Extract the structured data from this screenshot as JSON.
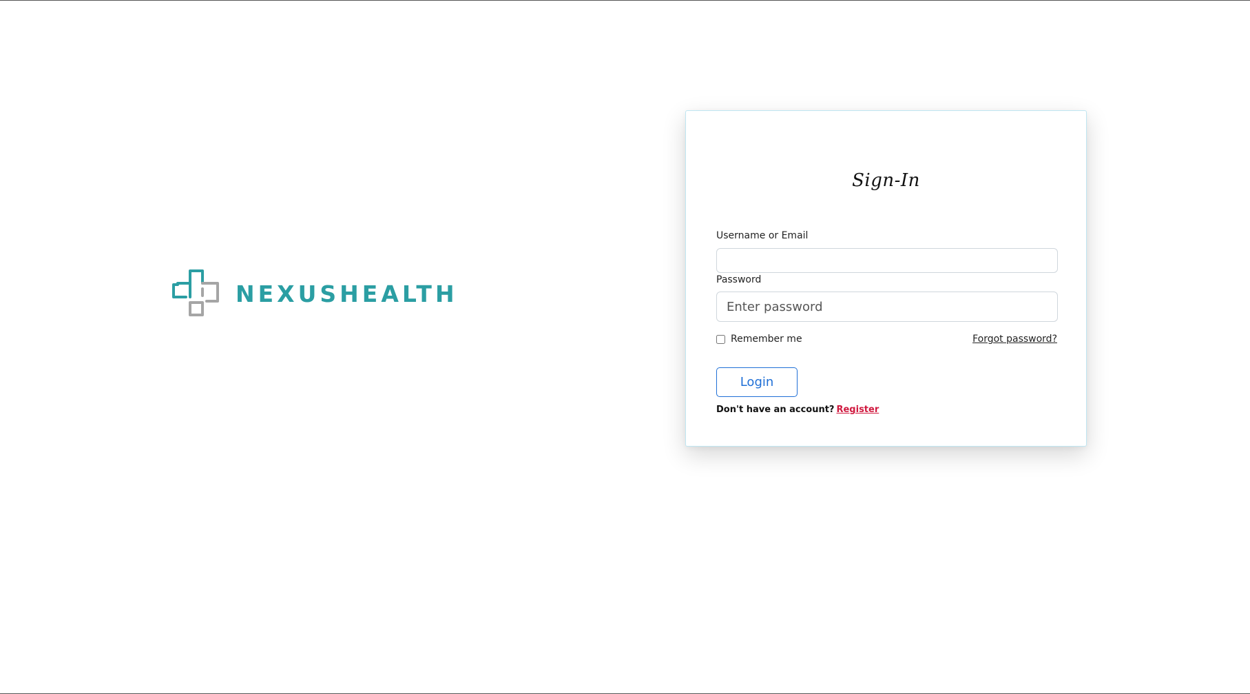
{
  "brand": {
    "name": "NEXUSHEALTH",
    "logo_icon": "medical-cross-logo-icon",
    "primary_color": "#2b9ea3",
    "secondary_color": "#a5a5a5"
  },
  "login_card": {
    "title": "Sign-In",
    "username_label": "Username or Email",
    "username_value": "",
    "username_placeholder": "",
    "password_label": "Password",
    "password_value": "",
    "password_placeholder": "Enter password",
    "remember_label": "Remember me",
    "remember_checked": false,
    "forgot_label": "Forgot password?",
    "login_label": "Login",
    "register_prompt": "Don't have an account?",
    "register_label": "Register",
    "accent_color": "#1f6fd6",
    "register_color": "#d0193f"
  }
}
